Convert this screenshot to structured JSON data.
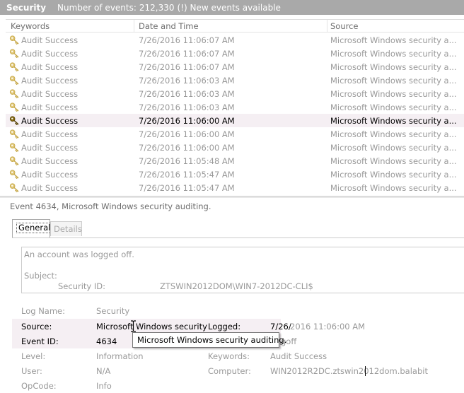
{
  "title": {
    "log_name": "Security",
    "events_label": "Number of events:",
    "events_count": "212,330",
    "new_events": "(!) New events available"
  },
  "columns": [
    "Keywords",
    "Date and Time",
    "Source"
  ],
  "rows": [
    {
      "keyword": "Audit Success",
      "datetime": "7/26/2016 11:06:07 AM",
      "source": "Microsoft Windows security a..."
    },
    {
      "keyword": "Audit Success",
      "datetime": "7/26/2016 11:06:07 AM",
      "source": "Microsoft Windows security a..."
    },
    {
      "keyword": "Audit Success",
      "datetime": "7/26/2016 11:06:07 AM",
      "source": "Microsoft Windows security a..."
    },
    {
      "keyword": "Audit Success",
      "datetime": "7/26/2016 11:06:03 AM",
      "source": "Microsoft Windows security a..."
    },
    {
      "keyword": "Audit Success",
      "datetime": "7/26/2016 11:06:03 AM",
      "source": "Microsoft Windows security a..."
    },
    {
      "keyword": "Audit Success",
      "datetime": "7/26/2016 11:06:03 AM",
      "source": "Microsoft Windows security a..."
    },
    {
      "keyword": "Audit Success",
      "datetime": "7/26/2016 11:06:00 AM",
      "source": "Microsoft Windows security a..."
    },
    {
      "keyword": "Audit Success",
      "datetime": "7/26/2016 11:06:00 AM",
      "source": "Microsoft Windows security a..."
    },
    {
      "keyword": "Audit Success",
      "datetime": "7/26/2016 11:06:00 AM",
      "source": "Microsoft Windows security a..."
    },
    {
      "keyword": "Audit Success",
      "datetime": "7/26/2016 11:05:48 AM",
      "source": "Microsoft Windows security a..."
    },
    {
      "keyword": "Audit Success",
      "datetime": "7/26/2016 11:05:47 AM",
      "source": "Microsoft Windows security a..."
    },
    {
      "keyword": "Audit Success",
      "datetime": "7/26/2016 11:05:47 AM",
      "source": "Microsoft Windows security a..."
    }
  ],
  "selected_row_index": 6,
  "event_title": "Event 4634, Microsoft Windows security auditing.",
  "tabs": {
    "general": "General",
    "details": "Details"
  },
  "description": {
    "line1": "An account was logged off.",
    "subject": "Subject:",
    "security_id_label": "Security ID:",
    "security_id_value": "ZTSWIN2012DOM\\WIN7-2012DC-CLI$"
  },
  "props": {
    "log_name_label": "Log Name:",
    "log_name_value": "Security",
    "source_label": "Source:",
    "source_value": "Microsoft Windows security",
    "logged_label": "Logged:",
    "logged_value_a": "7/26/",
    "logged_value_b": "2016 11:06:00 AM",
    "event_id_label": "Event ID:",
    "event_id_value": "4634",
    "task_partial": "goff",
    "level_label": "Level:",
    "level_value": "Information",
    "keywords_label": "Keywords:",
    "keywords_value": "Audit Success",
    "user_label": "User:",
    "user_value": "N/A",
    "computer_label": "Computer:",
    "computer_value": "WIN2012R2DC.ztswin2012dom.balabit",
    "opcode_label": "OpCode:",
    "opcode_value": "Info"
  },
  "tooltip": "Microsoft Windows security auditing.",
  "colors": {
    "titlebar": "#a9a9a9",
    "selected_row": "#f5eff3",
    "dim_text": "#999999"
  }
}
